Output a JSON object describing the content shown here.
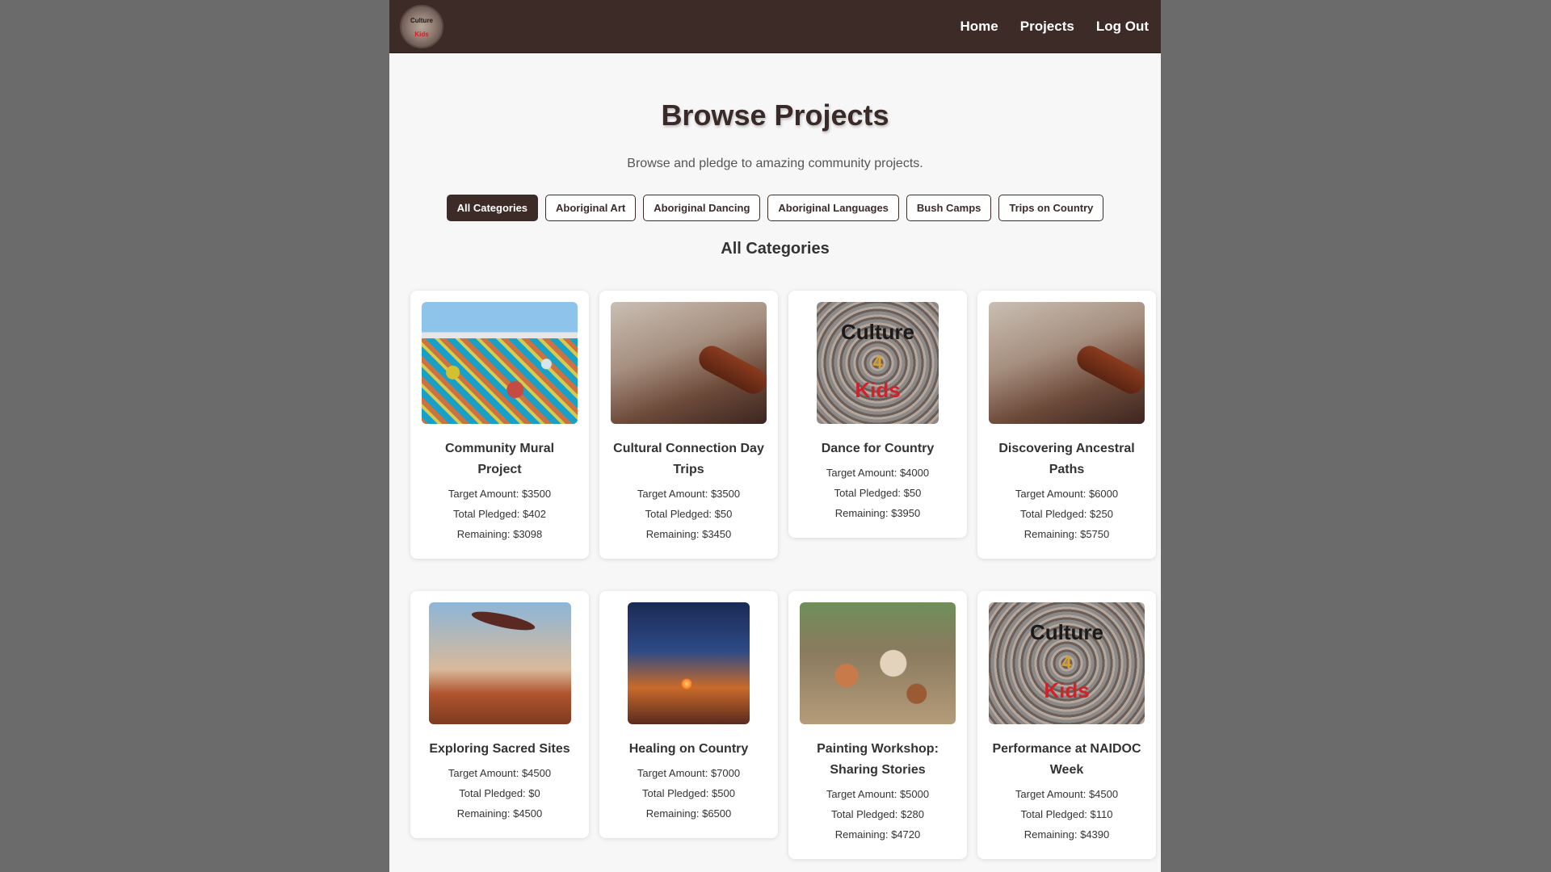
{
  "nav": {
    "logo_line1": "Culture",
    "logo_line2": "Kids",
    "links": [
      "Home",
      "Projects",
      "Log Out"
    ]
  },
  "page": {
    "title": "Browse Projects",
    "subtitle": "Browse and pledge to amazing community projects.",
    "section_title": "All Categories"
  },
  "filters": {
    "active": "All Categories",
    "items": [
      "All Categories",
      "Aboriginal Art",
      "Aboriginal Dancing",
      "Aboriginal Languages",
      "Bush Camps",
      "Trips on Country"
    ]
  },
  "logo_image_text": {
    "line1": "Culture",
    "line2": "4",
    "line3": "Kids"
  },
  "projects": [
    {
      "title": "Community Mural Project",
      "target": "Target Amount: $3500",
      "pledged": "Total Pledged: $402",
      "remaining": "Remaining: $3098"
    },
    {
      "title": "Cultural Connection Day Trips",
      "target": "Target Amount: $3500",
      "pledged": "Total Pledged: $50",
      "remaining": "Remaining: $3450"
    },
    {
      "title": "Dance for Country",
      "target": "Target Amount: $4000",
      "pledged": "Total Pledged: $50",
      "remaining": "Remaining: $3950"
    },
    {
      "title": "Discovering Ancestral Paths",
      "target": "Target Amount: $6000",
      "pledged": "Total Pledged: $250",
      "remaining": "Remaining: $5750"
    },
    {
      "title": "Exploring Sacred Sites",
      "target": "Target Amount: $4500",
      "pledged": "Total Pledged: $0",
      "remaining": "Remaining: $4500"
    },
    {
      "title": "Healing on Country",
      "target": "Target Amount: $7000",
      "pledged": "Total Pledged: $500",
      "remaining": "Remaining: $6500"
    },
    {
      "title": "Painting Workshop: Sharing Stories",
      "target": "Target Amount: $5000",
      "pledged": "Total Pledged: $280",
      "remaining": "Remaining: $4720"
    },
    {
      "title": "Performance at NAIDOC Week",
      "target": "Target Amount: $4500",
      "pledged": "Total Pledged: $110",
      "remaining": "Remaining: $4390"
    }
  ],
  "colors": {
    "nav_bg": "#3d2b28",
    "page_bg": "#f7f7f7",
    "backdrop": "#6b6b6b"
  }
}
